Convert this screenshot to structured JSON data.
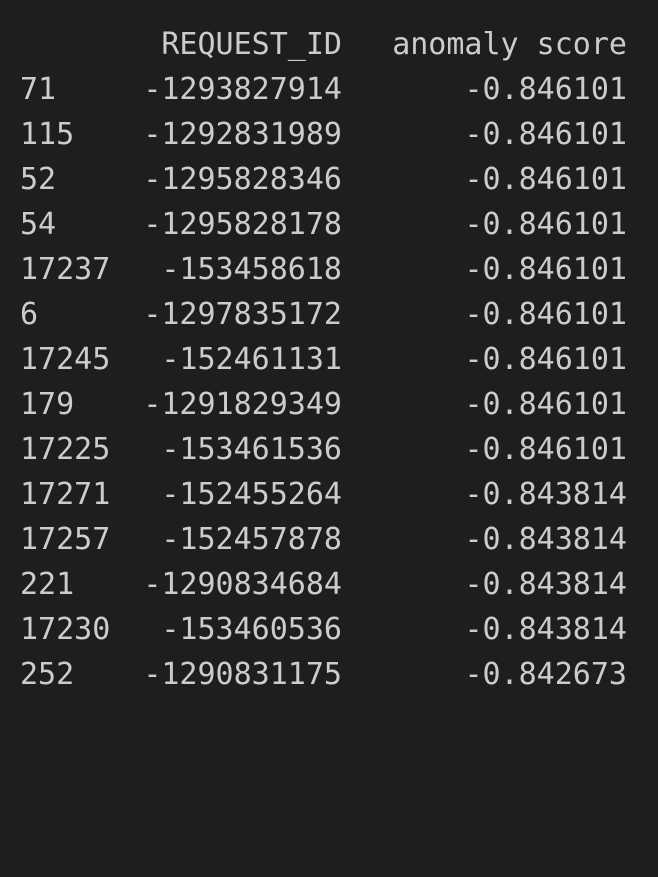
{
  "table": {
    "columns": [
      "",
      "REQUEST_ID",
      "anomaly score"
    ],
    "rows": [
      {
        "index": "71",
        "request_id": "-1293827914",
        "score": "-0.846101"
      },
      {
        "index": "115",
        "request_id": "-1292831989",
        "score": "-0.846101"
      },
      {
        "index": "52",
        "request_id": "-1295828346",
        "score": "-0.846101"
      },
      {
        "index": "54",
        "request_id": "-1295828178",
        "score": "-0.846101"
      },
      {
        "index": "17237",
        "request_id": "-153458618",
        "score": "-0.846101"
      },
      {
        "index": "6",
        "request_id": "-1297835172",
        "score": "-0.846101"
      },
      {
        "index": "17245",
        "request_id": "-152461131",
        "score": "-0.846101"
      },
      {
        "index": "179",
        "request_id": "-1291829349",
        "score": "-0.846101"
      },
      {
        "index": "17225",
        "request_id": "-153461536",
        "score": "-0.846101"
      },
      {
        "index": "17271",
        "request_id": "-152455264",
        "score": "-0.843814"
      },
      {
        "index": "17257",
        "request_id": "-152457878",
        "score": "-0.843814"
      },
      {
        "index": "221",
        "request_id": "-1290834684",
        "score": "-0.843814"
      },
      {
        "index": "17230",
        "request_id": "-153460536",
        "score": "-0.843814"
      },
      {
        "index": "252",
        "request_id": "-1290831175",
        "score": "-0.842673"
      }
    ]
  }
}
